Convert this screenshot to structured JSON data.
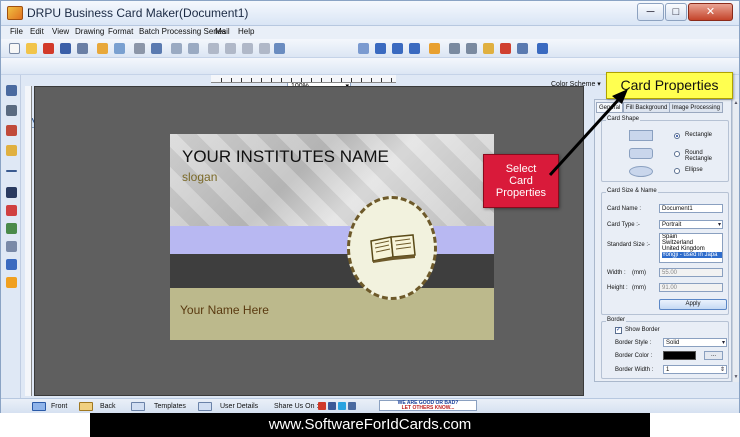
{
  "window": {
    "title": "DRPU Business Card Maker(Document1)"
  },
  "menu": [
    "File",
    "Edit",
    "View",
    "Drawing",
    "Format",
    "Batch Processing Series",
    "Mail",
    "Help"
  ],
  "toolbar": {
    "zoom": "100%",
    "color_scheme": "Color Scheme"
  },
  "card": {
    "title": "YOUR INSTITUTES NAME",
    "slogan": "slogan",
    "name": "Your Name Here"
  },
  "panel": {
    "tabs": [
      "General",
      "Fill Background",
      "Image Processing"
    ],
    "card_shape": {
      "label": "Card Shape",
      "options": [
        "Rectangle",
        "Round Rectangle",
        "Ellipse"
      ],
      "selected": "Rectangle"
    },
    "size_name": {
      "label": "Card Size & Name",
      "card_name_label": "Card Name :",
      "card_name": "Document1",
      "card_type_label": "Card Type :-",
      "card_type": "Portrait",
      "standard_size_label": "Standard Size :-",
      "standard_sizes": [
        "Spain",
        "Switzerland",
        "United Kingdom",
        "Yongji - used in Japa"
      ],
      "selected_size": "Yongji - used in Japa",
      "width_label": "Width :",
      "width_unit": "(mm)",
      "width": "55.00",
      "height_label": "Height :",
      "height_unit": "(mm)",
      "height": "91.00",
      "apply": "Apply"
    },
    "border": {
      "label": "Border",
      "show_border_label": "Show Border",
      "show_border": true,
      "border_style_label": "Border Style :",
      "border_style": "Solid",
      "border_color_label": "Border Color :",
      "border_color": "#000000",
      "color_button": "...",
      "border_width_label": "Border Width :",
      "border_width": "1"
    }
  },
  "status": {
    "front": "Front",
    "back": "Back",
    "templates": "Templates",
    "user_details": "User Details",
    "share": "Share Us On :",
    "ad_line1": "WE ARE GOOD OR BAD?",
    "ad_line2": "LET OTHERS KNOW..."
  },
  "callouts": {
    "card_properties": "Card Properties",
    "select_line1": "Select",
    "select_line2": "Card",
    "select_line3": "Properties"
  },
  "footer": "www.SoftwareForIdCards.com",
  "colors": {
    "accent_callout": "#d91a3a",
    "highlight": "#ffff50",
    "canvas": "#5f5f5f"
  }
}
